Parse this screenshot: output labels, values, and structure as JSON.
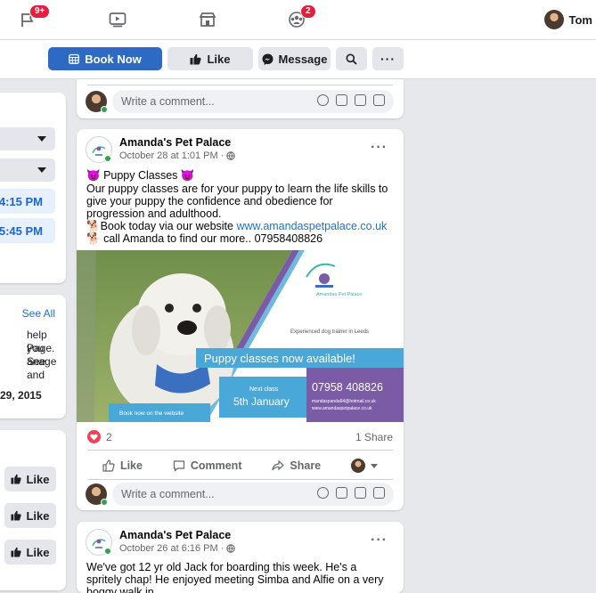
{
  "topbar": {
    "flag_badge": "9+",
    "groups_badge": "2",
    "user_name": "Tom"
  },
  "actions": {
    "book_now": "Book Now",
    "like": "Like",
    "message": "Message"
  },
  "sidebar": {
    "time_slots": [
      "4:15 PM",
      "5:45 PM"
    ],
    "see_all": "See All",
    "about_lines": [
      "help you",
      "Page. See",
      "anage and"
    ],
    "date": "29, 2015",
    "like_buttons": [
      "Like",
      "Like",
      "Like"
    ]
  },
  "comment_placeholder": "Write a comment...",
  "posts": [
    {
      "page_name": "Amanda's Pet Palace",
      "meta": "October 28 at 1:01 PM ·",
      "text_title": "Puppy Classes",
      "text_body": "Our puppy classes are for your puppy to learn the life skills to give your puppy the confidence and obedience for progression and adulthood.",
      "book_prefix": "Book today via our website ",
      "website": "www.amandaspetpalace.co.uk",
      "call_text": "call Amanda to find our more.. 07958408826",
      "image": {
        "logo_caption": "Amandas Pet Palace",
        "trainer_text": "Experienced dog trainer in Leeds",
        "banner": "Puppy classes now available!",
        "next_class_label": "Next class",
        "next_class_date": "5th January",
        "phone": "07958 408826",
        "email": "mandaspanda84@hotmail.co.uk",
        "site": "www.amandaspetpalace.co.uk",
        "book_online": "Book now on the website"
      },
      "reaction_count": "2",
      "shares": "1 Share",
      "actions": [
        "Like",
        "Comment",
        "Share"
      ]
    },
    {
      "page_name": "Amanda's Pet Palace",
      "meta": "October 26 at 6:16 PM ·",
      "text_body": "We've got 12 yr old Jack for boarding this week. He's a spritely chap! He enjoyed meeting Simba and Alfie on a very boggy walk in"
    }
  ],
  "colors": {
    "primary": "#2d6ac4",
    "badge": "#e41e3f",
    "link": "#216fdb",
    "banner_blue": "#4aa8d8",
    "panel_purple": "#7b5aa6"
  }
}
